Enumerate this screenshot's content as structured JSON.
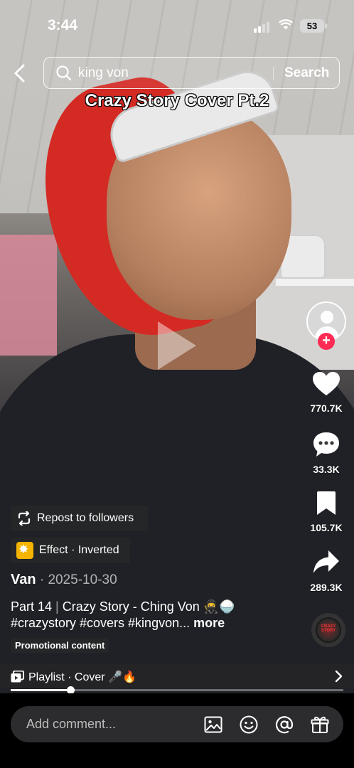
{
  "status_bar": {
    "time": "3:44",
    "battery": "53"
  },
  "search": {
    "query": "king von",
    "button_label": "Search"
  },
  "video": {
    "caption_overlay": "Crazy Story Cover Pt.2"
  },
  "actions": {
    "likes": "770.7K",
    "comments": "33.3K",
    "saves": "105.7K",
    "shares": "289.3K",
    "follow_symbol": "+"
  },
  "chips": {
    "repost": "Repost to followers",
    "effect": "Effect · Inverted",
    "promo": "Promotional content"
  },
  "post": {
    "author": "Van",
    "date": " · 2025-10-30",
    "desc_part": "Part 14",
    "desc_separator": " | ",
    "desc_title": "Crazy Story - Ching Von 🥷🍚",
    "hashtags": "#crazystory #covers #kingvon...",
    "more_label": " more"
  },
  "music_disc_label": "CRAZY STORY",
  "playlist": {
    "label": "Playlist · Cover 🎤🔥",
    "progress": 0.18
  },
  "comment": {
    "placeholder": "Add comment..."
  },
  "icons": [
    "back-icon",
    "search-icon",
    "heart-icon",
    "comment-icon",
    "bookmark-icon",
    "share-icon",
    "repost-icon",
    "effect-icon",
    "playlist-icon",
    "chevron-right-icon",
    "image-icon",
    "emoji-icon",
    "mention-icon",
    "gift-icon"
  ]
}
